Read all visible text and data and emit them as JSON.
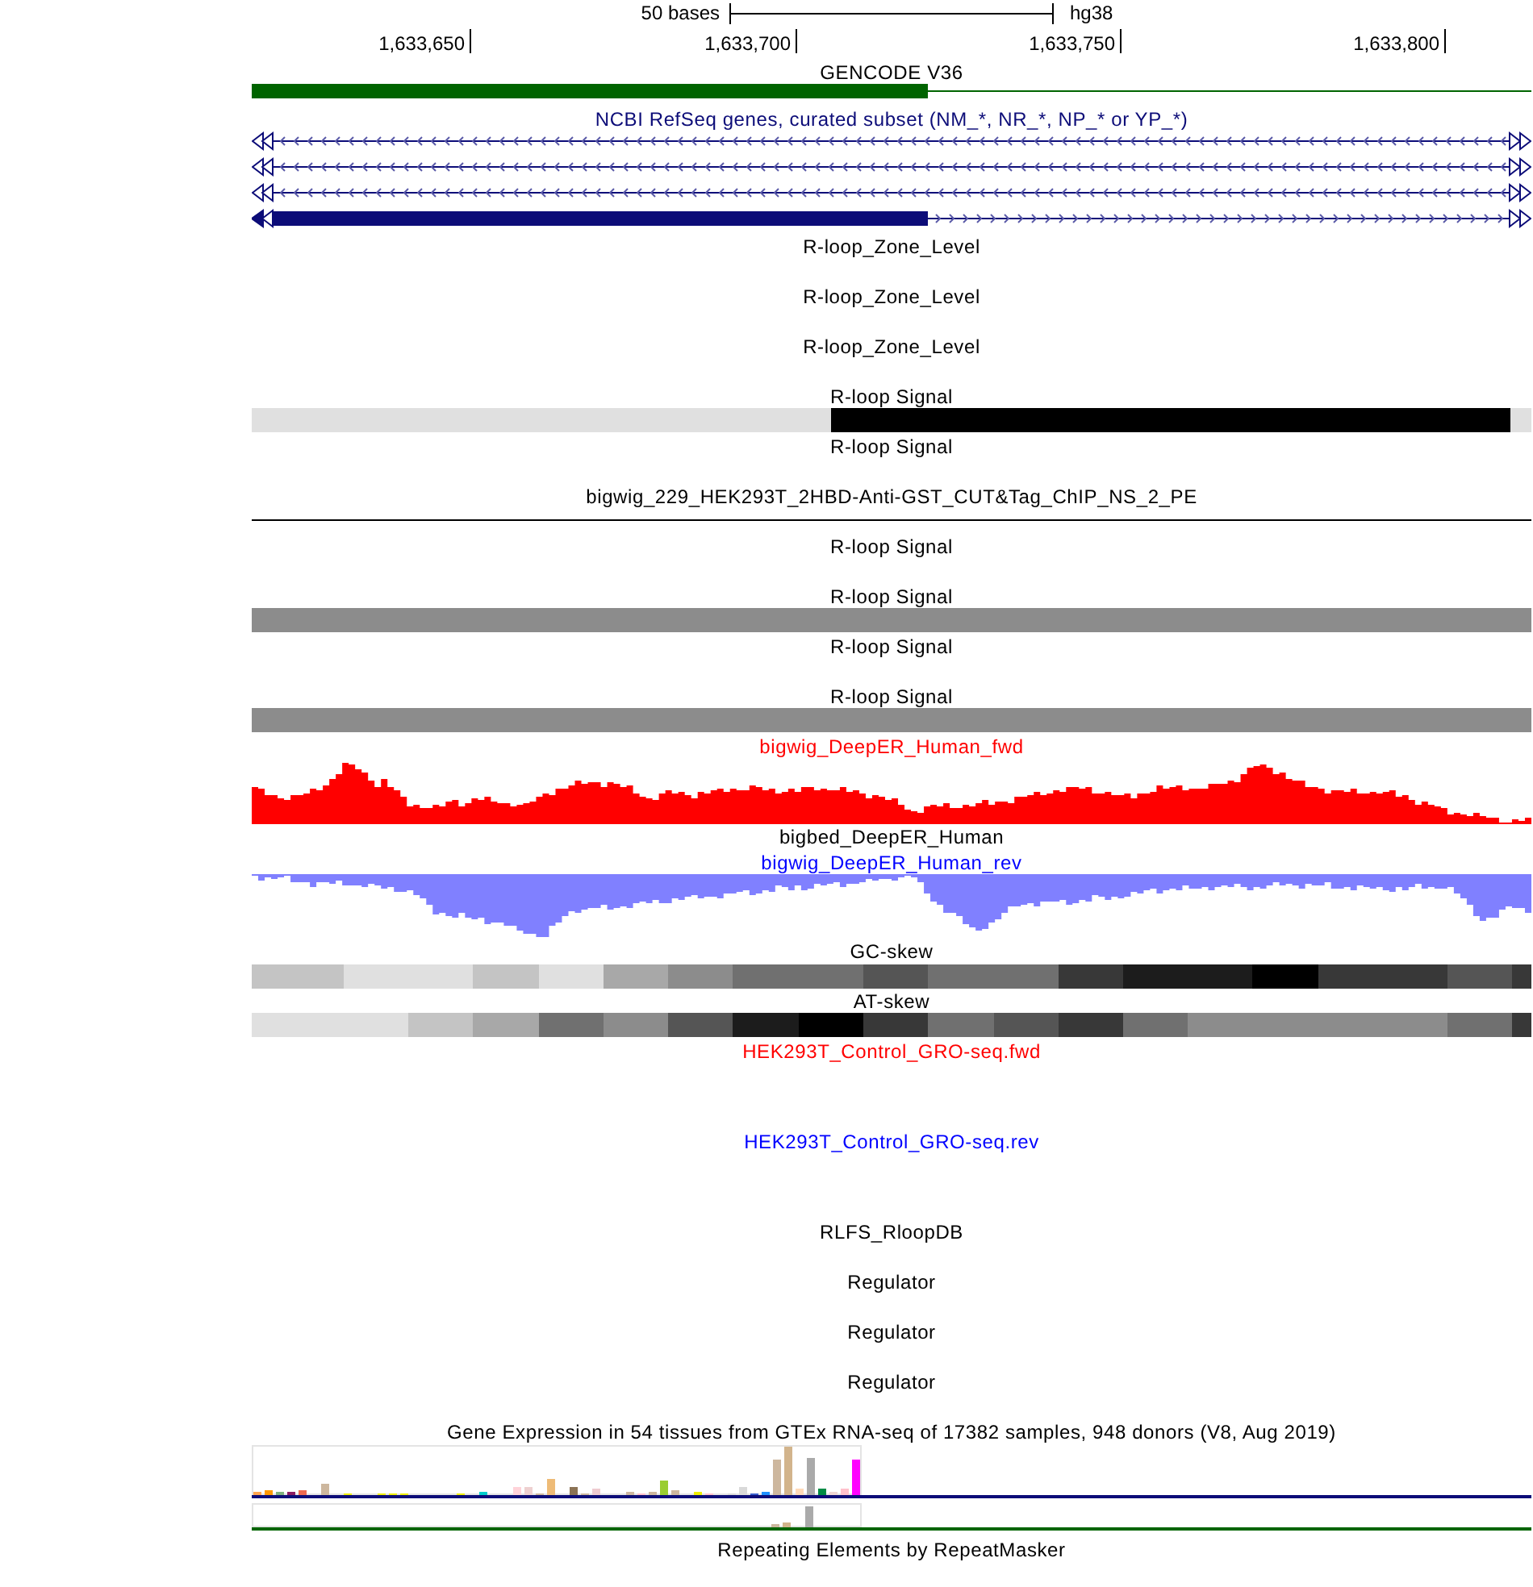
{
  "ruler": {
    "scale_label": "50 bases",
    "assembly": "hg38",
    "positions": [
      "1,633,650",
      "1,633,700",
      "1,633,750",
      "1,633,800"
    ]
  },
  "tracks": [
    {
      "label": "GENCODE V36",
      "color": "#000000",
      "kind": "gene"
    },
    {
      "label": "NCBI RefSeq genes, curated subset (NM_*, NR_*, NP_* or YP_*)",
      "color": "#0c0c78",
      "kind": "transcripts"
    },
    {
      "label": "R-loop_Zone_Level",
      "color": "#000000",
      "kind": "blank"
    },
    {
      "label": "R-loop_Zone_Level",
      "color": "#000000",
      "kind": "blank"
    },
    {
      "label": "R-loop_Zone_Level",
      "color": "#000000",
      "kind": "blank"
    },
    {
      "label": "R-loop Signal",
      "color": "#000000",
      "kind": "peak"
    },
    {
      "label": "R-loop Signal",
      "color": "#000000",
      "kind": "blank"
    },
    {
      "label": "bigwig_229_HEK293T_2HBD-Anti-GST_CUT&Tag_ChIP_NS_2_PE",
      "color": "#000000",
      "kind": "line"
    },
    {
      "label": "R-loop Signal",
      "color": "#000000",
      "kind": "blank"
    },
    {
      "label": "R-loop Signal",
      "color": "#000000",
      "kind": "band"
    },
    {
      "label": "R-loop Signal",
      "color": "#000000",
      "kind": "blank"
    },
    {
      "label": "R-loop Signal",
      "color": "#000000",
      "kind": "band"
    },
    {
      "label": "bigwig_DeepER_Human_fwd",
      "color": "#ff0000",
      "kind": "forward"
    },
    {
      "label": "bigbed_DeepER_Human",
      "color": "#000000",
      "kind": "compact"
    },
    {
      "label": "bigwig_DeepER_Human_rev",
      "color": "#0000ff",
      "kind": "reverse"
    },
    {
      "label": "GC-skew",
      "color": "#000000",
      "kind": "gcskew"
    },
    {
      "label": "AT-skew",
      "color": "#000000",
      "kind": "atskew"
    },
    {
      "label": "HEK293T_Control_GRO-seq.fwd",
      "color": "#ff0000",
      "kind": "wiggle"
    },
    {
      "label": "HEK293T_Control_GRO-seq.rev",
      "color": "#0000ff",
      "kind": "wiggle"
    },
    {
      "label": "RLFS_RloopDB",
      "color": "#000000",
      "kind": "blank"
    },
    {
      "label": "Regulator",
      "color": "#000000",
      "kind": "blank"
    },
    {
      "label": "Regulator",
      "color": "#000000",
      "kind": "blank"
    },
    {
      "label": "Regulator",
      "color": "#000000",
      "kind": "blank"
    },
    {
      "label": "Gene Expression in 54 tissues from GTEx RNA-seq of 17382 samples, 948 donors (V8, Aug 2019)",
      "color": "#000000",
      "kind": "expression"
    },
    {
      "label": "Repeating Elements by RepeatMasker",
      "color": "#000000",
      "kind": "blank"
    }
  ]
}
